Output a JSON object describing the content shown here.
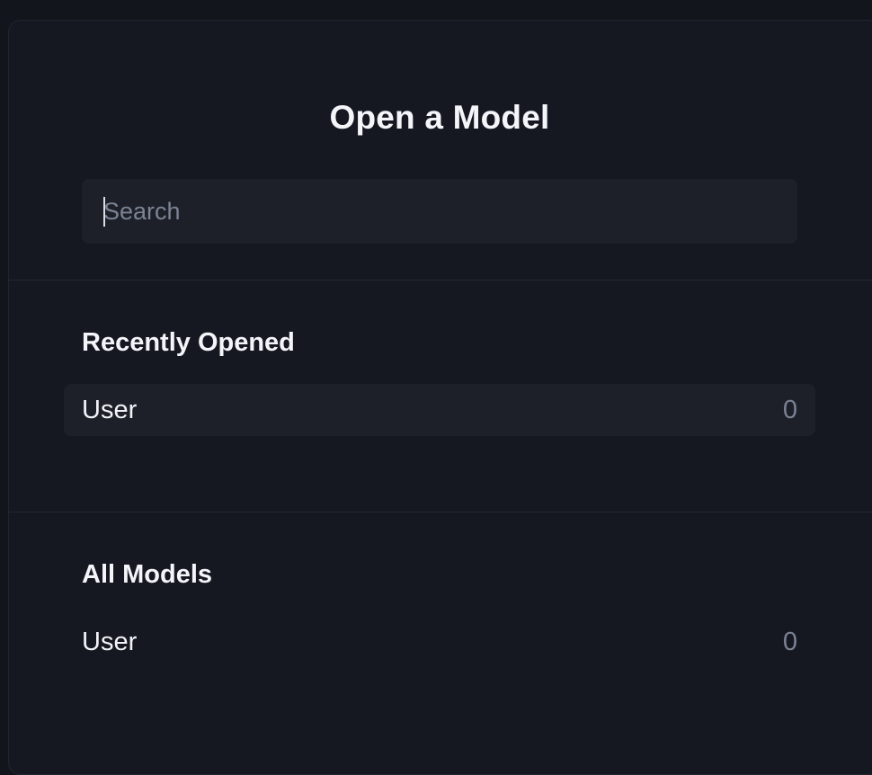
{
  "dialog": {
    "title": "Open a Model"
  },
  "search": {
    "placeholder": "Search",
    "value": ""
  },
  "recently_opened": {
    "heading": "Recently Opened",
    "items": [
      {
        "name": "User",
        "count": "0"
      }
    ]
  },
  "all_models": {
    "heading": "All Models",
    "items": [
      {
        "name": "User",
        "count": "0"
      }
    ]
  },
  "colors": {
    "background": "#13151c",
    "dialog": "#151821",
    "input": "#1d2029",
    "text": "#f1f3f7",
    "muted": "#7a8292"
  }
}
